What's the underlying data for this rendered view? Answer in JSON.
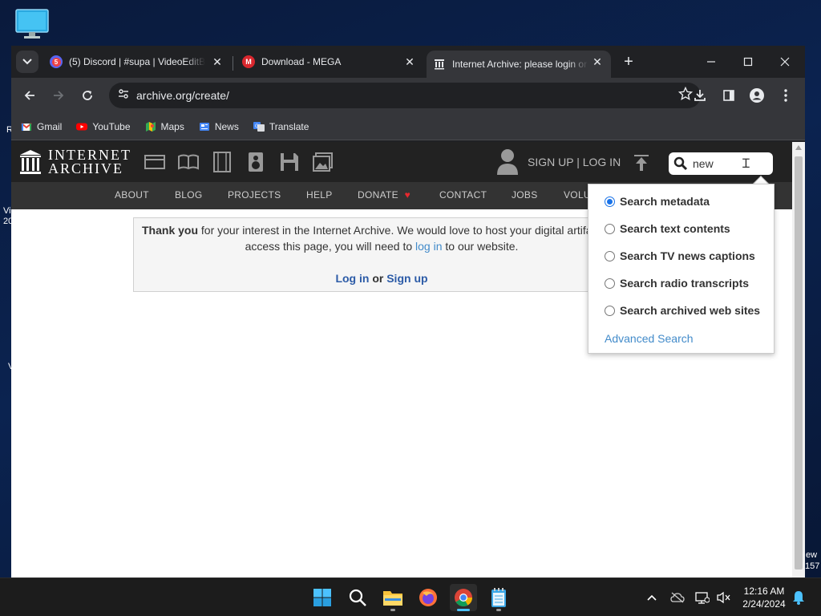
{
  "desktop": {
    "icon": "monitor-icon",
    "fragments": [
      "R",
      "Vi",
      "20",
      "V",
      "ew",
      "157"
    ]
  },
  "browser": {
    "tabs": [
      {
        "title": "(5) Discord | #supa | VideoEditB",
        "icon": "discord-icon",
        "badge": "5"
      },
      {
        "title": "Download - MEGA",
        "icon": "mega-icon",
        "badge": "M"
      },
      {
        "title": "Internet Archive: please login or",
        "icon": "archive-icon"
      }
    ],
    "new_tab": "+",
    "url": "archive.org/create/",
    "bookmarks": [
      {
        "label": "Gmail",
        "icon": "gmail-icon"
      },
      {
        "label": "YouTube",
        "icon": "youtube-icon"
      },
      {
        "label": "Maps",
        "icon": "maps-icon"
      },
      {
        "label": "News",
        "icon": "news-icon"
      },
      {
        "label": "Translate",
        "icon": "translate-icon"
      }
    ]
  },
  "ia": {
    "logo_line1": "INTERNET",
    "logo_line2": "ARCHIVE",
    "signup_login": "SIGN UP | LOG IN",
    "search_query": "new",
    "nav": [
      "ABOUT",
      "BLOG",
      "PROJECTS",
      "HELP",
      "DONATE",
      "CONTACT",
      "JOBS",
      "VOLU"
    ],
    "notice": {
      "bold": "Thank you",
      "line1_rest": " for your interest in the Internet Archive. We would love to host your digital artifa",
      "line2_a": "access this page, you will need to ",
      "line2_link": "log in",
      "line2_b": " to our website.",
      "login": "Log in",
      "or": " or ",
      "signup": "Sign up"
    },
    "search_options": [
      {
        "label": "Search metadata",
        "checked": true
      },
      {
        "label": "Search text contents",
        "checked": false
      },
      {
        "label": "Search TV news captions",
        "checked": false
      },
      {
        "label": "Search radio transcripts",
        "checked": false
      },
      {
        "label": "Search archived web sites",
        "checked": false
      }
    ],
    "advanced_search": "Advanced Search"
  },
  "taskbar": {
    "time": "12:16 AM",
    "date": "2/24/2024"
  },
  "colors": {
    "ia_dark": "#222222",
    "ia_nav": "#333333",
    "link": "#428bca",
    "accent": "#1a73e8",
    "donate_heart": "#e8282e"
  }
}
